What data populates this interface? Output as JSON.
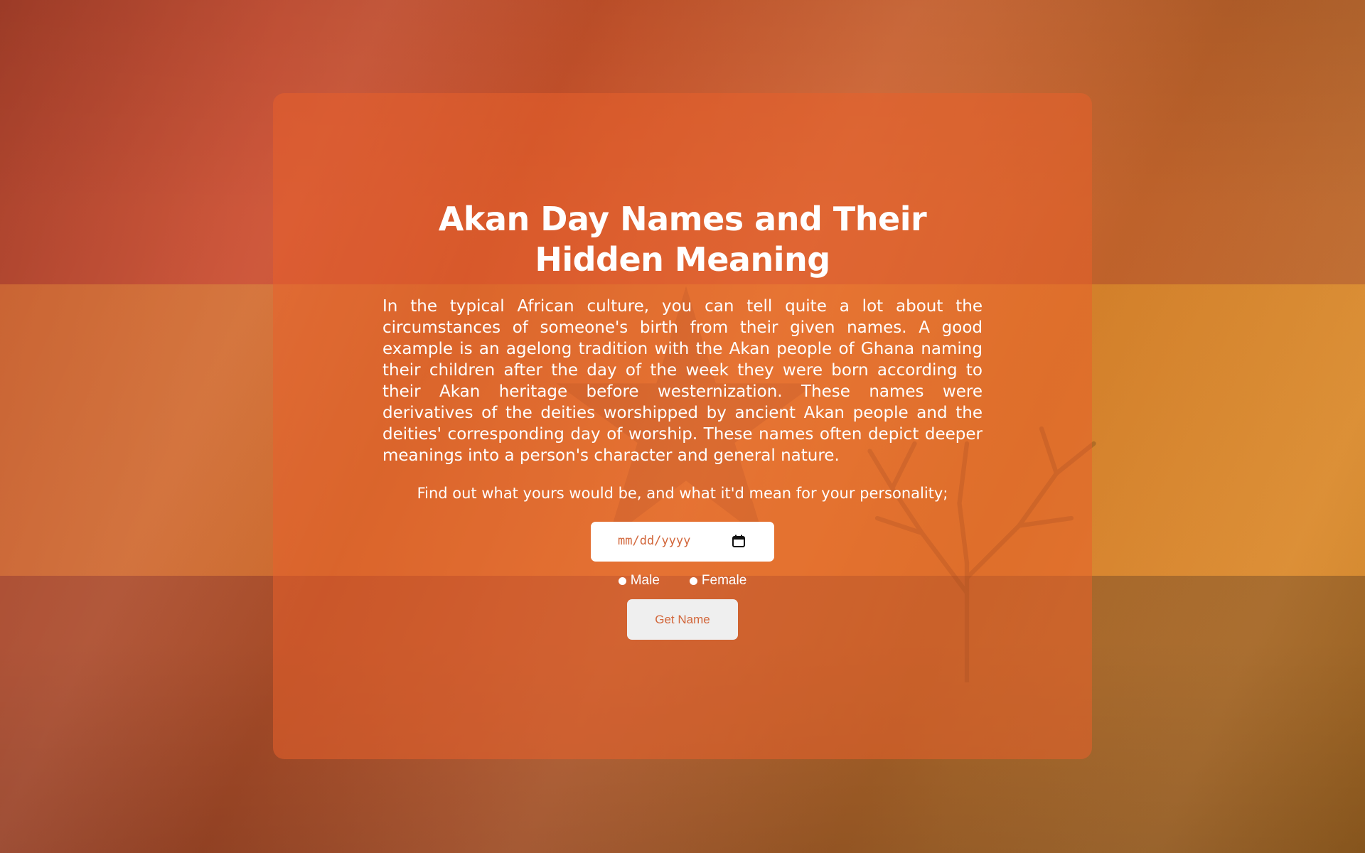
{
  "page": {
    "title": "Akan Day Names and Their Hidden Meaning",
    "intro": "In the typical African culture, you can tell quite a lot about the circumstances of someone's birth from their given names. A good example is an agelong tradition with the Akan people of Ghana naming their children after the day of the week they were born according to their Akan heritage before westernization. These names were derivatives of the deities worshipped by ancient Akan people and the deities' corresponding day of worship. These names often depict deeper meanings into a person's character and general nature.",
    "prompt": "Find out what yours would be, and what it'd mean for your personality;"
  },
  "form": {
    "date_placeholder": "mm/dd/yyyy",
    "gender_options": [
      "Male",
      "Female"
    ],
    "submit_label": "Get Name"
  },
  "colors": {
    "accent": "#d2663a",
    "card": "#e8602c",
    "button_bg": "#efefef"
  },
  "icons": {
    "date_picker": "calendar-icon"
  }
}
